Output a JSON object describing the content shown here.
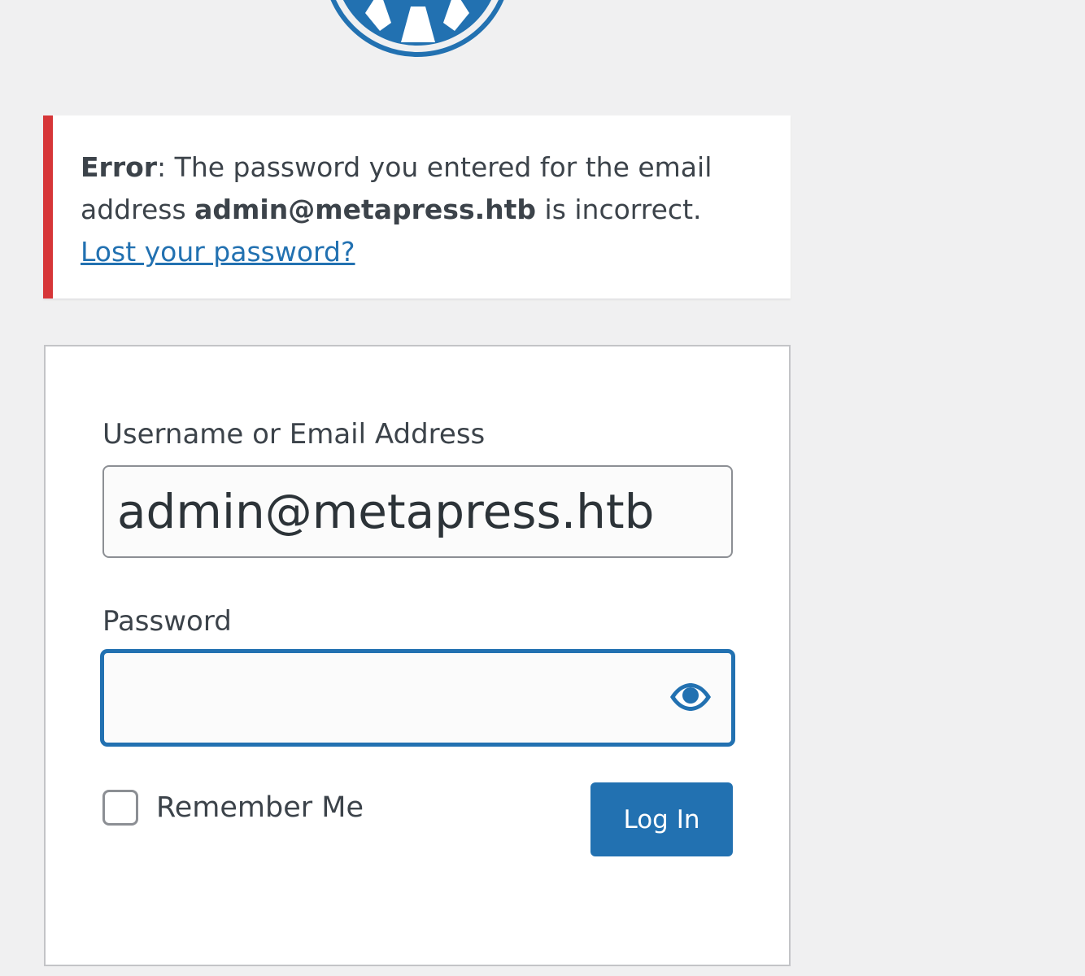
{
  "notice": {
    "error_label": "Error",
    "message_before": ": The password you entered for the email address ",
    "email": "admin@metapress.htb",
    "message_after": " is incorrect. ",
    "lost_password_link": "Lost your password?"
  },
  "form": {
    "username_label": "Username or Email Address",
    "username_value": "admin@metapress.htb",
    "password_label": "Password",
    "password_value": "",
    "remember_label": "Remember Me",
    "remember_checked": false,
    "submit_label": "Log In"
  },
  "icons": {
    "logo": "wordpress-logo-icon",
    "toggle_password": "eye-icon"
  },
  "colors": {
    "background": "#f0f0f1",
    "accent": "#2271b1",
    "error": "#d63638",
    "text": "#3c434a",
    "card": "#ffffff"
  }
}
